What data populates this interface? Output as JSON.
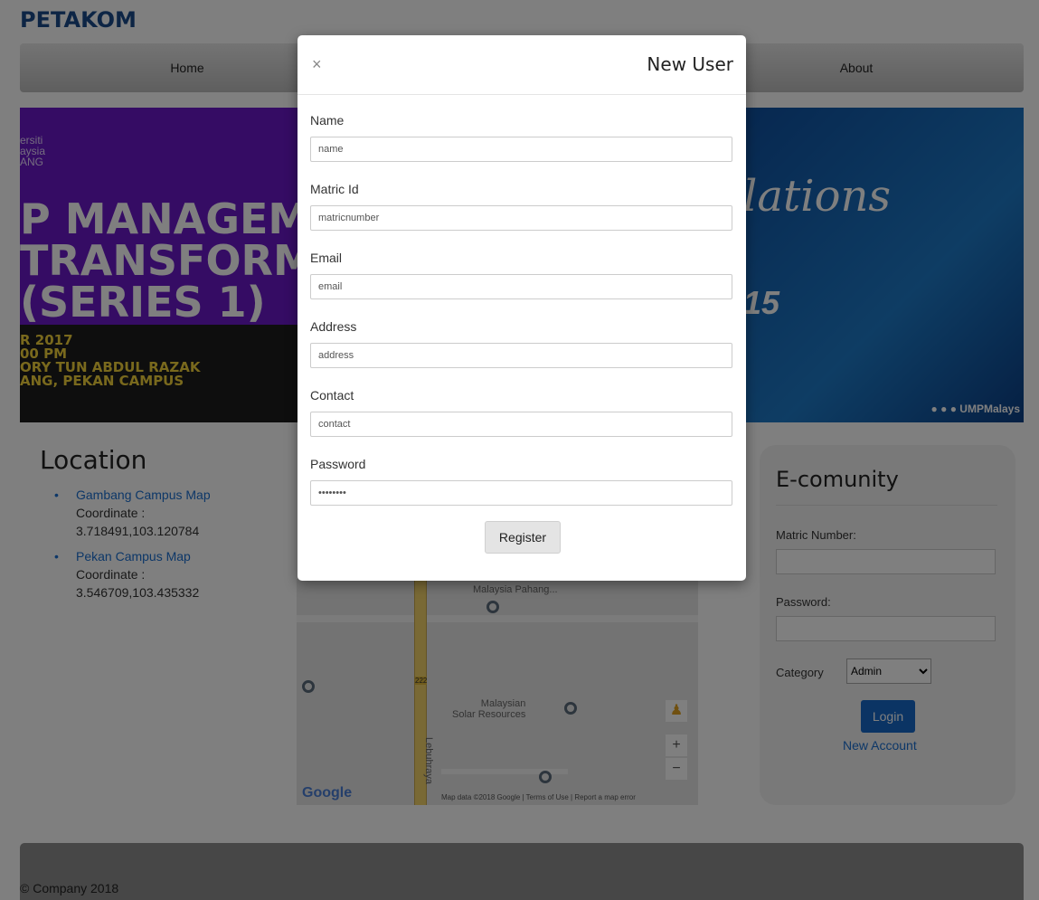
{
  "brand": "PETAKOM",
  "nav": {
    "items": [
      "Home",
      "About"
    ]
  },
  "banner": {
    "left_university": "ersiti\naysia\nANG",
    "left_headline": "P MANAGEM\nTRANSFORMA\n(SERIES 1)",
    "left_info": "R 2017\n00 PM\nORY TUN ABDUL RAZAK\nANG, PEKAN CAMPUS",
    "right_script": "lations",
    "right_logo": "15",
    "right_social": "UMPMalays"
  },
  "location": {
    "title": "Location",
    "items": [
      {
        "link": "Gambang Campus Map",
        "label": "Coordinate :",
        "coords": "3.718491,103.120784"
      },
      {
        "link": "Pekan Campus Map",
        "label": "Coordinate :",
        "coords": "3.546709,103.435332"
      }
    ]
  },
  "map": {
    "labels": [
      "Malaysia Pahang...",
      "Malaysian\nSolar Resources",
      "Lebuhraya",
      "222"
    ],
    "google": "Google",
    "data_text": "Map data ©2018 Google | Terms of Use | Report a map error",
    "zoom_in": "+",
    "zoom_out": "−"
  },
  "ecomm": {
    "title": "E-comunity",
    "matric_label": "Matric Number:",
    "password_label": "Password:",
    "category_label": "Category",
    "category_value": "Admin",
    "login_label": "Login",
    "new_account": "New Account"
  },
  "footer": "© Company 2018",
  "modal": {
    "title": "New User",
    "close": "×",
    "fields": [
      {
        "label": "Name",
        "value": "name"
      },
      {
        "label": "Matric Id",
        "value": "matricnumber"
      },
      {
        "label": "Email",
        "value": "email"
      },
      {
        "label": "Address",
        "value": "address"
      },
      {
        "label": "Contact",
        "value": "contact"
      },
      {
        "label": "Password",
        "value": "••••••••"
      }
    ],
    "register": "Register"
  }
}
